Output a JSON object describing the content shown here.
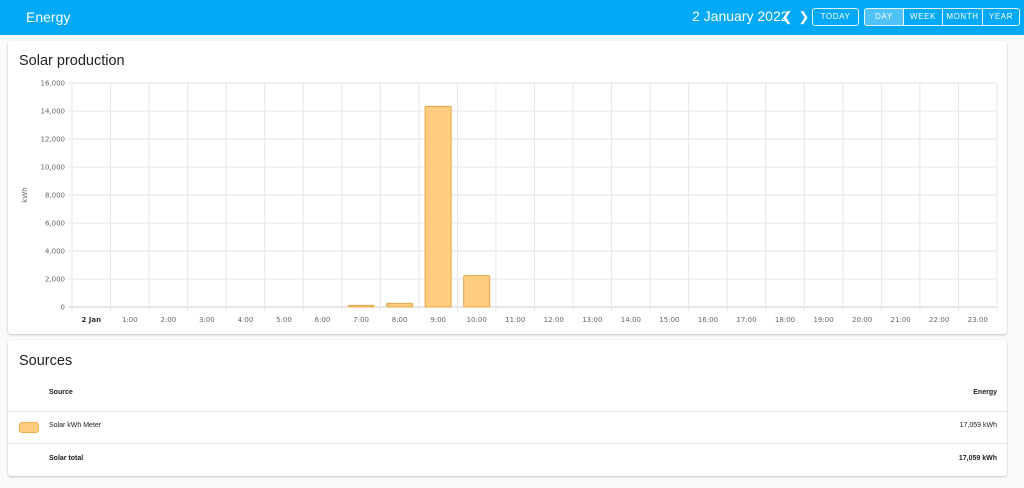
{
  "header": {
    "title": "Energy",
    "date": "2 January 2022",
    "prev_icon": "chevron-left-icon",
    "next_icon": "chevron-right-icon",
    "today_label": "TODAY",
    "ranges": [
      "DAY",
      "WEEK",
      "MONTH",
      "YEAR"
    ],
    "selected_range": "DAY"
  },
  "solar_card": {
    "title": "Solar production"
  },
  "chart_data": {
    "type": "bar",
    "ylabel": "kWh",
    "ylim": [
      0,
      16000
    ],
    "yticks": [
      "0",
      "2,000",
      "4,000",
      "6,000",
      "8,000",
      "10,000",
      "12,000",
      "14,000",
      "16,000"
    ],
    "categories": [
      "2 Jan",
      "1:00",
      "2:00",
      "3:00",
      "4:00",
      "5:00",
      "6:00",
      "7:00",
      "8:00",
      "9:00",
      "10:00",
      "11:00",
      "12:00",
      "13:00",
      "14:00",
      "15:00",
      "16:00",
      "17:00",
      "18:00",
      "19:00",
      "20:00",
      "21:00",
      "22:00",
      "23:00"
    ],
    "values": [
      0,
      0,
      0,
      0,
      0,
      0,
      0,
      120,
      260,
      14330,
      2240,
      0,
      0,
      0,
      0,
      0,
      0,
      0,
      0,
      0,
      0,
      0,
      0,
      0
    ],
    "grid": true,
    "colors": {
      "fill": "#ffcc80",
      "stroke": "#e0a846"
    }
  },
  "sources_card": {
    "title": "Sources",
    "col_source": "Source",
    "col_energy": "Energy",
    "rows": [
      {
        "name": "Solar kWh Meter",
        "value": "17,059 kWh",
        "color": "#ffcc80"
      }
    ],
    "total_label": "Solar total",
    "total_value": "17,059 kWh"
  }
}
